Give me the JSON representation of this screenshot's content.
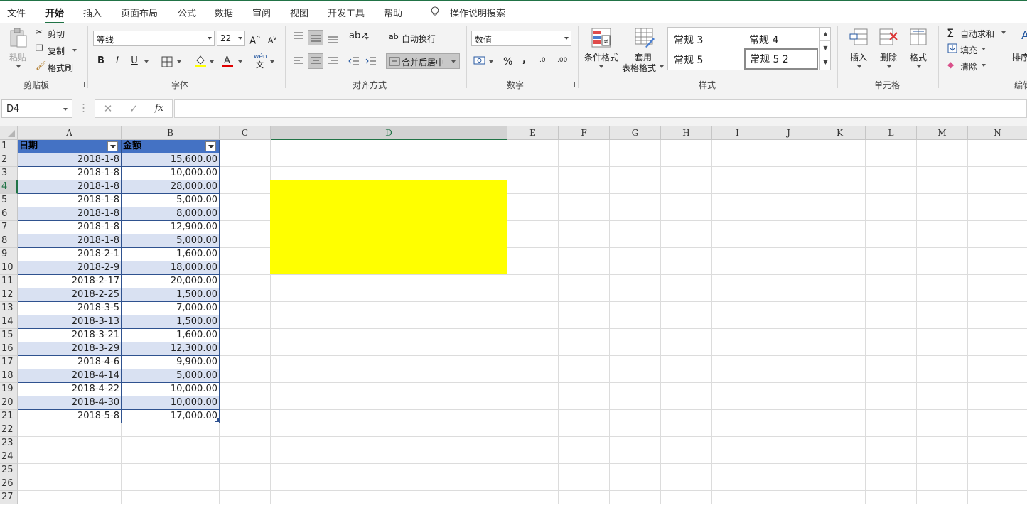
{
  "tabs": [
    "文件",
    "开始",
    "插入",
    "页面布局",
    "公式",
    "数据",
    "审阅",
    "视图",
    "开发工具",
    "帮助"
  ],
  "tell_me": "操作说明搜索",
  "clipboard": {
    "paste": "粘贴",
    "cut": "剪切",
    "copy": "复制",
    "format_painter": "格式刷",
    "label": "剪贴板"
  },
  "font": {
    "name": "等线",
    "size": "22",
    "bold": "B",
    "italic": "I",
    "underline": "U",
    "phonetic": "wén",
    "label": "字体"
  },
  "alignment": {
    "wrap": "自动换行",
    "merge": "合并后居中",
    "label": "对齐方式"
  },
  "number": {
    "format": "数值",
    "percent": "%",
    "comma": ",",
    "inc_decimal": ".0",
    "dec_decimal": ".00",
    "label": "数字"
  },
  "styles": {
    "conditional": "条件格式",
    "table_format_1": "套用",
    "table_format_2": "表格格式",
    "gallery": [
      "常规 3",
      "常规 4",
      "常规 5",
      "常规 5 2"
    ],
    "label": "样式"
  },
  "cells": {
    "insert": "插入",
    "delete": "删除",
    "format": "格式",
    "label": "单元格"
  },
  "editing": {
    "autosum": "自动求和",
    "fill": "填充",
    "clear": "清除",
    "sort": "排序",
    "label": "编辑"
  },
  "formula_bar": {
    "name_box": "D4",
    "cancel": "✕",
    "enter": "✓",
    "fx": "fx",
    "value": ""
  },
  "columns": [
    "A",
    "B",
    "C",
    "D",
    "E",
    "F",
    "G",
    "H",
    "I",
    "J",
    "K",
    "L",
    "M",
    "N"
  ],
  "table": {
    "headers": [
      "日期",
      "金额"
    ],
    "rows": [
      [
        "2018-1-8",
        "15,600.00"
      ],
      [
        "2018-1-8",
        "10,000.00"
      ],
      [
        "2018-1-8",
        "28,000.00"
      ],
      [
        "2018-1-8",
        "5,000.00"
      ],
      [
        "2018-1-8",
        "8,000.00"
      ],
      [
        "2018-1-8",
        "12,900.00"
      ],
      [
        "2018-1-8",
        "5,000.00"
      ],
      [
        "2018-2-1",
        "1,600.00"
      ],
      [
        "2018-2-9",
        "18,000.00"
      ],
      [
        "2018-2-17",
        "20,000.00"
      ],
      [
        "2018-2-25",
        "1,500.00"
      ],
      [
        "2018-3-5",
        "7,000.00"
      ],
      [
        "2018-3-13",
        "1,500.00"
      ],
      [
        "2018-3-21",
        "1,600.00"
      ],
      [
        "2018-3-29",
        "12,300.00"
      ],
      [
        "2018-4-6",
        "9,900.00"
      ],
      [
        "2018-4-14",
        "5,000.00"
      ],
      [
        "2018-4-22",
        "10,000.00"
      ],
      [
        "2018-4-30",
        "10,000.00"
      ],
      [
        "2018-5-8",
        "17,000.00"
      ]
    ]
  },
  "row_count": 27,
  "selected_cell": "D4",
  "highlight_fill": "#ffff00",
  "table_header_color": "#4472c4",
  "table_band_color": "#d9e1f2",
  "accent": "#217346"
}
